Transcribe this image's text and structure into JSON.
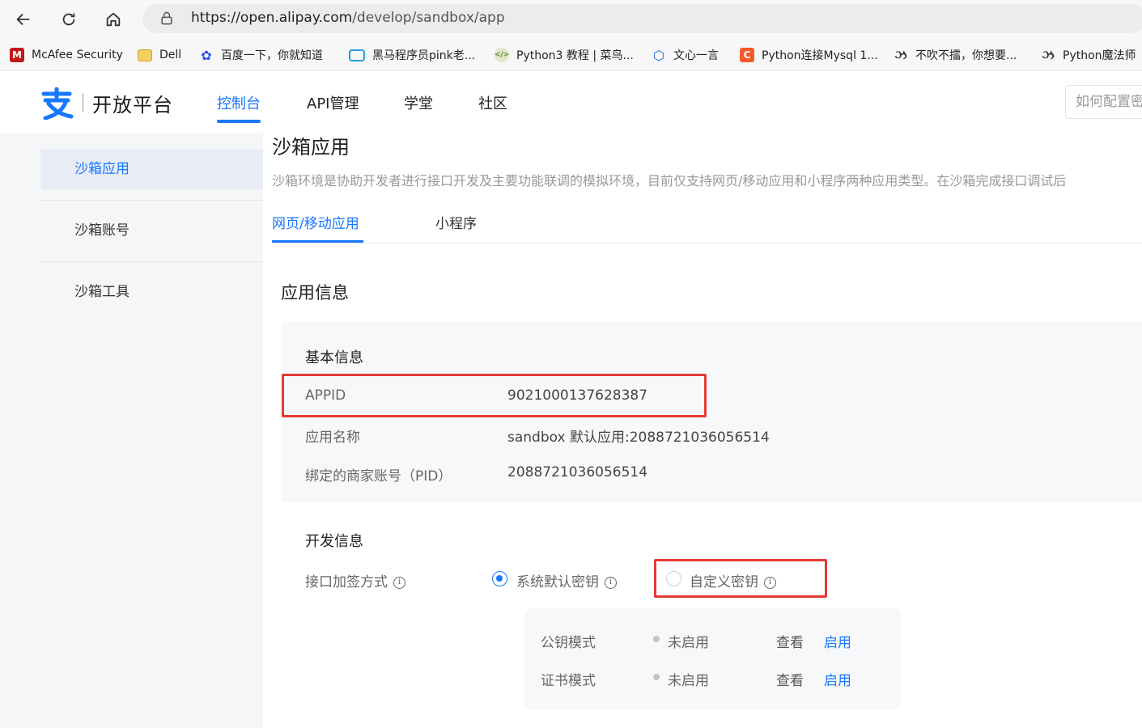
{
  "browser": {
    "url_host": "https://open.alipay.com",
    "url_path": "/develop/sandbox/app"
  },
  "bookmarks": [
    {
      "label": "McAfee Security",
      "icon": "mcafee-icon",
      "color": "#c01818"
    },
    {
      "label": "Dell",
      "icon": "folder-icon",
      "color": "#e8b93c"
    },
    {
      "label": "百度一下，你就知道",
      "icon": "baidu-paw-icon",
      "color": "#2d4ff0"
    },
    {
      "label": "黑马程序员pink老...",
      "icon": "bilibili-tv-icon",
      "color": "#23a0dd"
    },
    {
      "label": "Python3 教程 | 菜鸟...",
      "icon": "runoob-icon",
      "color": "#5c8a3a"
    },
    {
      "label": "文心一言",
      "icon": "wenxin-icon",
      "color": "#2f5fe0"
    },
    {
      "label": "Python连接Mysql 1...",
      "icon": "csdn-icon",
      "color": "#f25a29"
    },
    {
      "label": "不吹不擂，你想要...",
      "icon": "spiral-icon",
      "color": "#333333"
    },
    {
      "label": "Python魔法师",
      "icon": "spiral-icon",
      "color": "#333333"
    }
  ],
  "header": {
    "logo_text": "开放平台",
    "nav": [
      "控制台",
      "API管理",
      "学堂",
      "社区"
    ],
    "search_placeholder": "如何配置密钥"
  },
  "sidebar": {
    "items": [
      "沙箱应用",
      "沙箱账号",
      "沙箱工具"
    ]
  },
  "page": {
    "title": "沙箱应用",
    "description": "沙箱环境是协助开发者进行接口开发及主要功能联调的模拟环境，目前仅支持网页/移动应用和小程序两种应用类型。在沙箱完成接口调试后",
    "tabs": [
      "网页/移动应用",
      "小程序"
    ],
    "section_title": "应用信息",
    "basic_info": {
      "title": "基本信息",
      "rows": [
        {
          "label": "APPID",
          "value": "9021000137628387"
        },
        {
          "label": "应用名称",
          "value": "sandbox 默认应用:2088721036056514"
        },
        {
          "label": "绑定的商家账号（PID）",
          "value": "2088721036056514"
        }
      ]
    },
    "dev_info": {
      "title": "开发信息",
      "sign_label": "接口加签方式",
      "options": [
        "系统默认密钥",
        "自定义密钥"
      ],
      "modes": [
        {
          "label": "公钥模式",
          "status": "未启用",
          "view": "查看",
          "enable": "启用"
        },
        {
          "label": "证书模式",
          "status": "未启用",
          "view": "查看",
          "enable": "启用"
        }
      ]
    }
  },
  "colors": {
    "accent": "#1677ff",
    "highlight_box": "#e53935"
  }
}
